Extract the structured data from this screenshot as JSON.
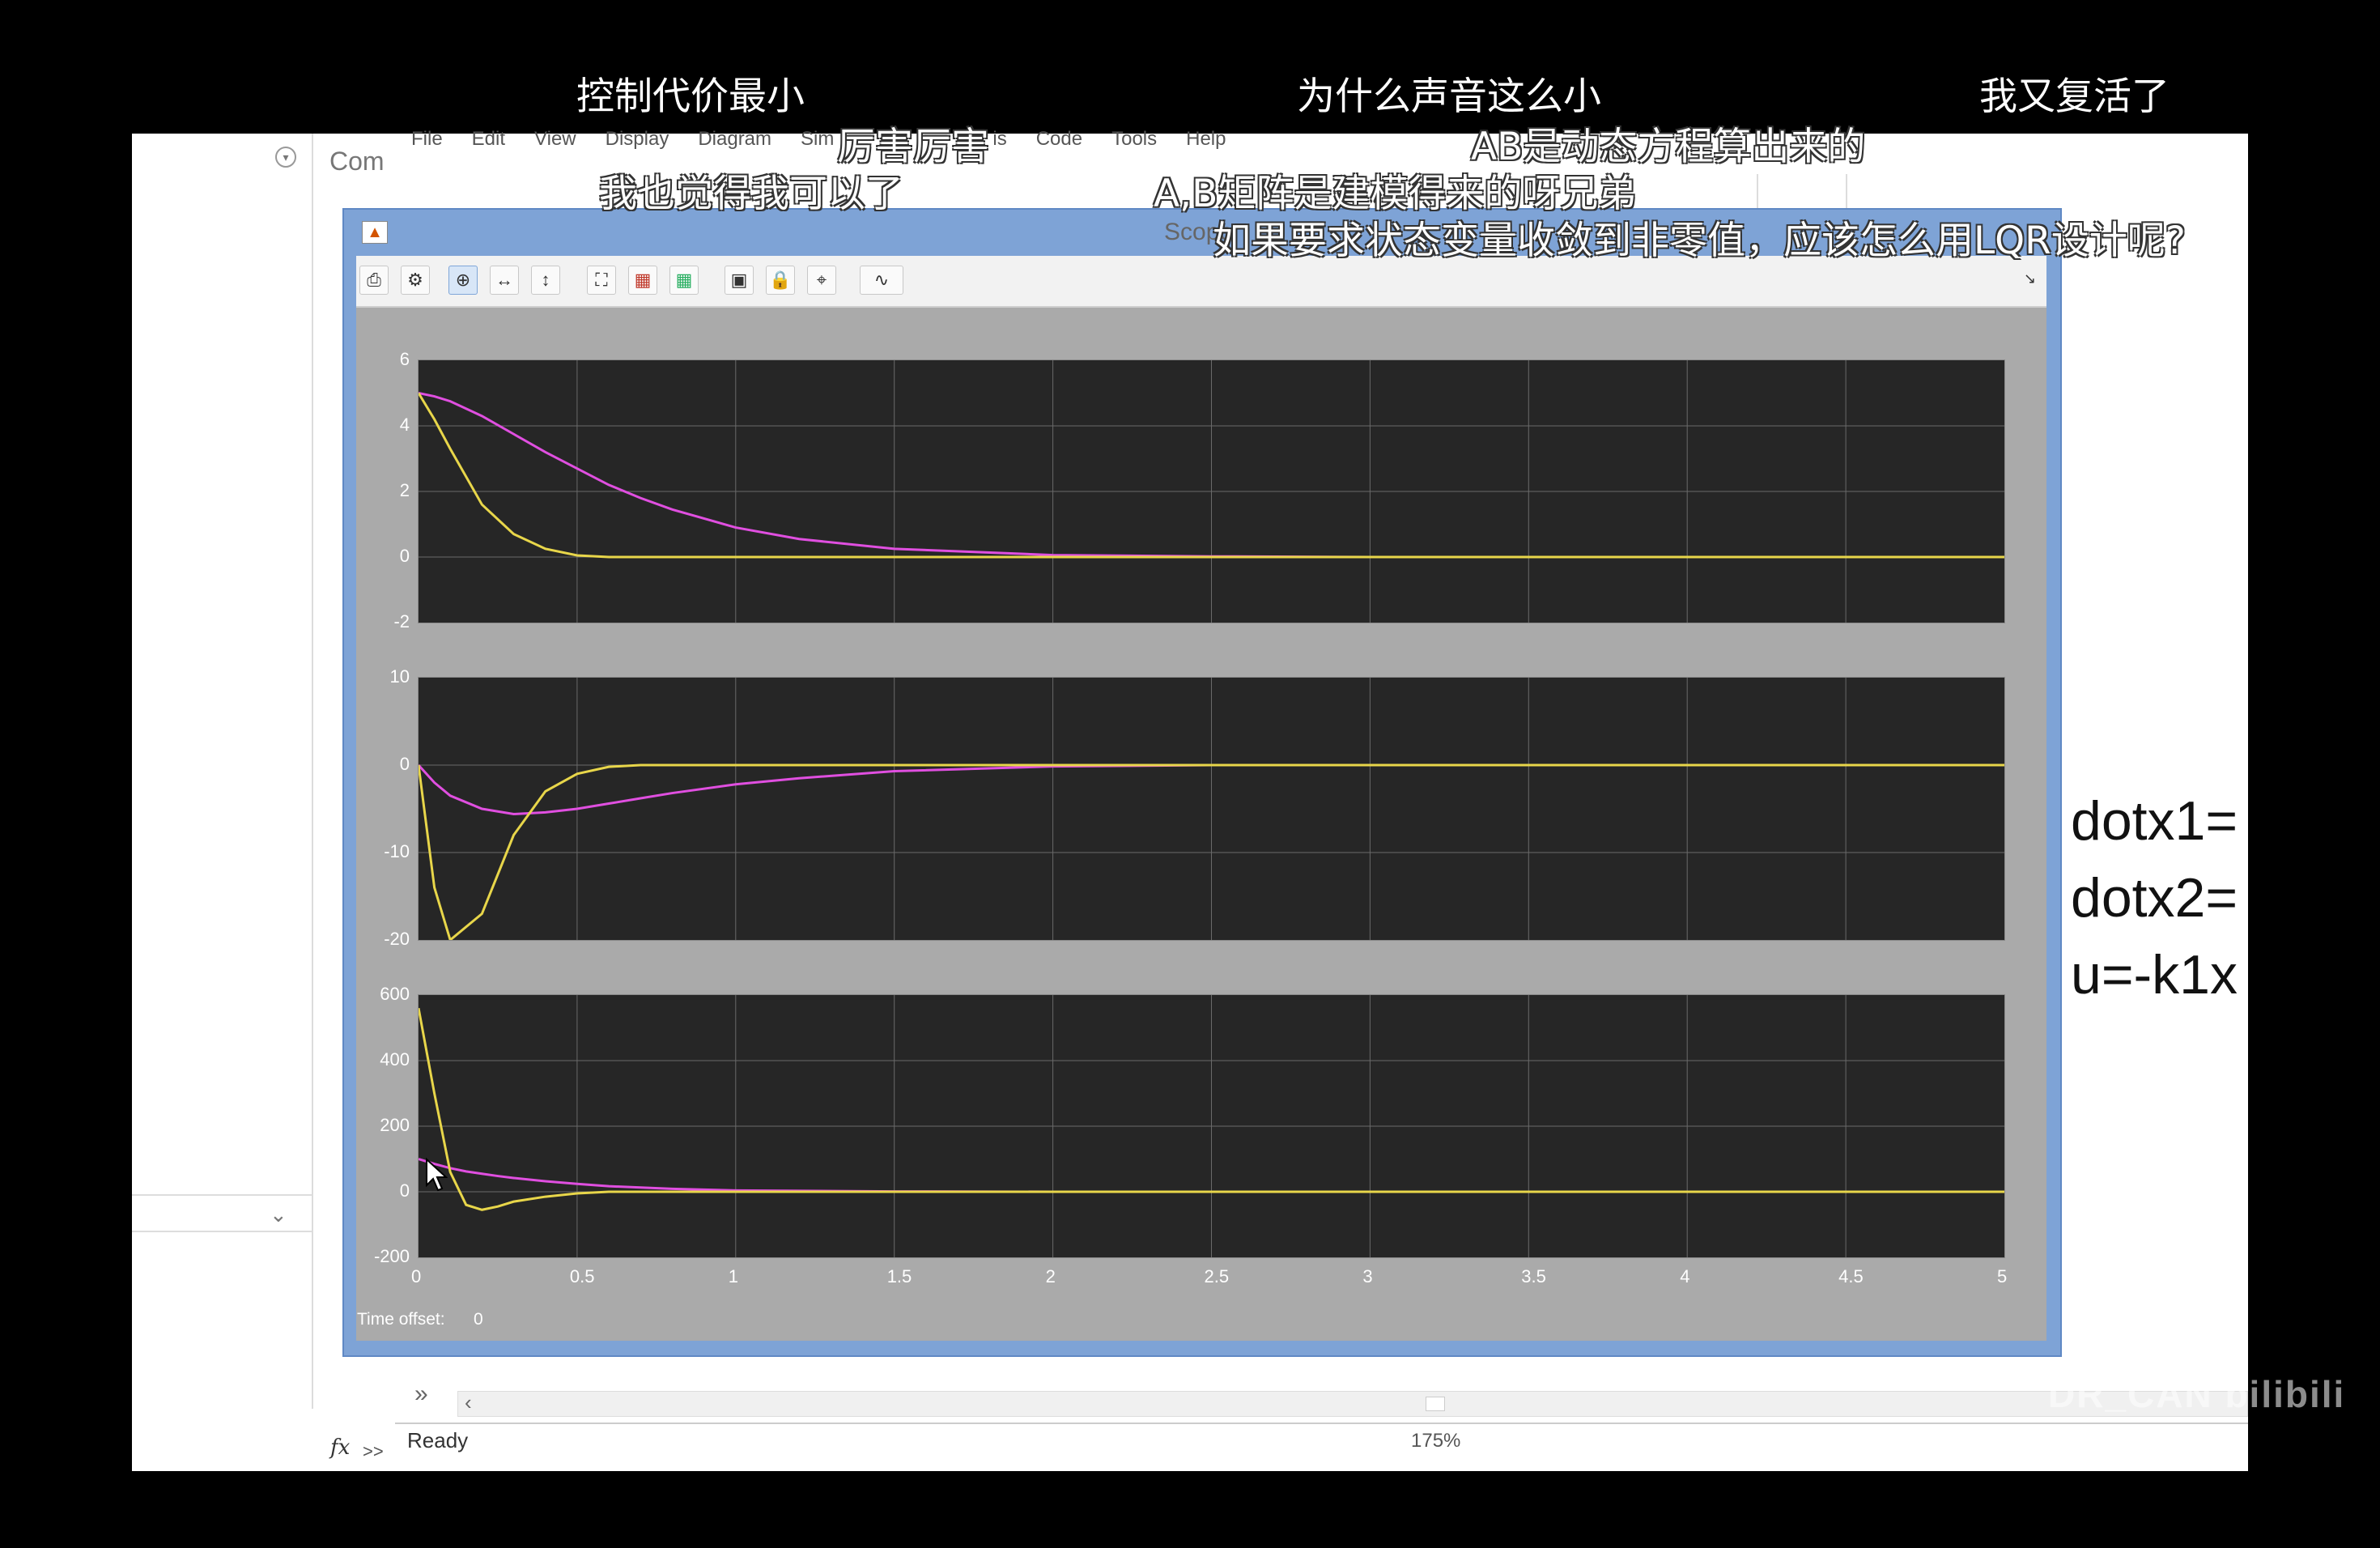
{
  "danmaku": [
    "控制代价最小",
    "为什么声音这么小",
    "我又复活了",
    "厉害厉害",
    "AB是动态方程算出来的",
    "我也觉得我可以了",
    "A,B矩阵是建模得来的呀兄弟",
    "如果要求状态变量收敛到非零值，应该怎么用LQR设计呢?"
  ],
  "background_window": {
    "left_panel_label": "Com",
    "menu": [
      "File",
      "Edit",
      "View",
      "Display",
      "Diagram",
      "Sim",
      "is",
      "Code",
      "Tools",
      "Help"
    ],
    "status_text": "Ready",
    "zoom": "175%",
    "fx_label": "fx",
    "expand_label": ">>",
    "equations": [
      "dotx1=",
      "dotx2=",
      "u=-k1x"
    ]
  },
  "scope": {
    "title": "Scope",
    "time_offset_label": "Time offset:",
    "time_offset_value": "0",
    "toolbar_icons": [
      "print-icon",
      "settings-icon",
      "zoom-in-icon",
      "zoom-x-icon",
      "zoom-y-icon",
      "fit-icon",
      "scale-x-icon",
      "scale-y-icon",
      "highlight-icon",
      "lock-icon",
      "cursor-icon",
      "signal-icon"
    ]
  },
  "watermark": "DR_CAN bilibili",
  "colors": {
    "series1": "#e04fe0",
    "series2": "#e8d64a",
    "axes_bg": "#262626",
    "scope_frame": "#7ea3d6"
  },
  "chart_data": [
    {
      "type": "line",
      "xlim": [
        0,
        5
      ],
      "ylim": [
        -2,
        6
      ],
      "x_ticks": [
        "0",
        "0.5",
        "1",
        "1.5",
        "2",
        "2.5",
        "3",
        "3.5",
        "4",
        "4.5",
        "5"
      ],
      "y_ticks": [
        "6",
        "4",
        "2",
        "0",
        "-2"
      ],
      "grid": true,
      "x": [
        0,
        0.05,
        0.1,
        0.2,
        0.3,
        0.4,
        0.5,
        0.6,
        0.7,
        0.8,
        1,
        1.2,
        1.5,
        2,
        2.5,
        3,
        5
      ],
      "series": [
        {
          "values": [
            5,
            4.9,
            4.75,
            4.3,
            3.75,
            3.2,
            2.7,
            2.2,
            1.8,
            1.45,
            0.9,
            0.55,
            0.25,
            0.06,
            0.02,
            0,
            0
          ]
        },
        {
          "values": [
            5,
            4.2,
            3.3,
            1.6,
            0.7,
            0.25,
            0.05,
            0,
            0,
            0,
            0,
            0,
            0,
            0,
            0,
            0,
            0
          ]
        }
      ]
    },
    {
      "type": "line",
      "xlim": [
        0,
        5
      ],
      "ylim": [
        -20,
        10
      ],
      "y_ticks": [
        "10",
        "0",
        "-10",
        "-20"
      ],
      "grid": true,
      "x": [
        0,
        0.05,
        0.1,
        0.2,
        0.3,
        0.4,
        0.5,
        0.6,
        0.7,
        0.8,
        1,
        1.2,
        1.5,
        2,
        2.5,
        3,
        5
      ],
      "series": [
        {
          "values": [
            0,
            -2,
            -3.5,
            -5,
            -5.6,
            -5.4,
            -5,
            -4.4,
            -3.8,
            -3.2,
            -2.2,
            -1.5,
            -0.7,
            -0.15,
            0,
            0,
            0
          ]
        },
        {
          "values": [
            0,
            -14,
            -20,
            -17,
            -8,
            -3,
            -1,
            -0.2,
            0,
            0,
            0,
            0,
            0,
            0,
            0,
            0,
            0
          ]
        }
      ]
    },
    {
      "type": "line",
      "xlim": [
        0,
        5
      ],
      "ylim": [
        -200,
        600
      ],
      "y_ticks": [
        "600",
        "400",
        "200",
        "0",
        "-200"
      ],
      "grid": true,
      "x": [
        0,
        0.05,
        0.1,
        0.15,
        0.2,
        0.25,
        0.3,
        0.4,
        0.5,
        0.6,
        0.8,
        1,
        1.5,
        2,
        3,
        5
      ],
      "series": [
        {
          "values": [
            100,
            85,
            72,
            62,
            55,
            48,
            42,
            32,
            24,
            17,
            9,
            4,
            1,
            0,
            0,
            0
          ]
        },
        {
          "values": [
            560,
            300,
            60,
            -40,
            -55,
            -45,
            -30,
            -15,
            -5,
            0,
            0,
            0,
            0,
            0,
            0,
            0
          ]
        }
      ]
    }
  ]
}
